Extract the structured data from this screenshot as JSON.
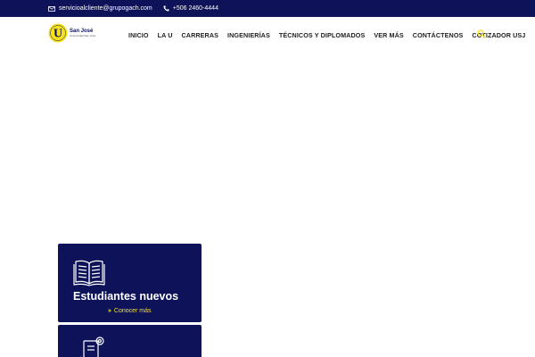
{
  "topbar": {
    "email": "servicioalcliente@grupogach.com",
    "phone": "+506 2460-4444"
  },
  "logo": {
    "letter": "U",
    "name": "San José",
    "subtitle": "Universidad San José"
  },
  "nav": {
    "items": [
      "INICIO",
      "LA U",
      "CARRERAS",
      "INGENIERÍAS",
      "TÉCNICOS Y DIPLOMADOS",
      "VER MÁS",
      "CONTÁCTENOS",
      "COTIZADOR USJ"
    ]
  },
  "icons": {
    "email": "envelope-icon",
    "phone": "phone-icon",
    "search": "search-icon",
    "card1": "open-book-icon",
    "card2": "document-gear-icon",
    "link": "double-chevron-right-icon"
  },
  "cards": [
    {
      "title": "Estudiantes nuevos",
      "link": "Conocer más"
    }
  ],
  "colors": {
    "brand_navy": "#0d1259",
    "accent_yellow": "#f5e11d"
  }
}
